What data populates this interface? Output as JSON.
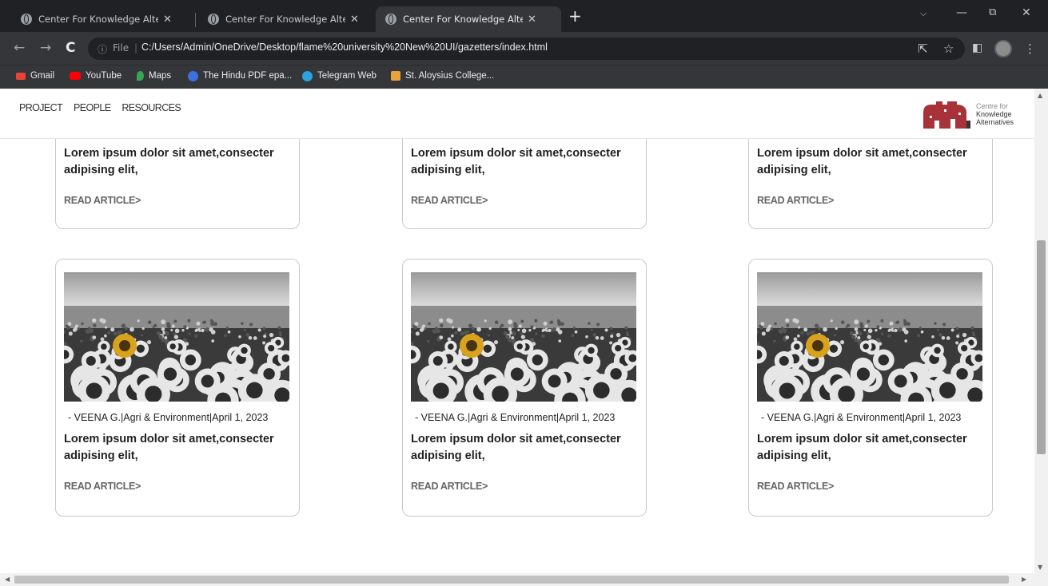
{
  "browser": {
    "tabs": [
      {
        "title": "Center For Knowledge Alternative",
        "active": false
      },
      {
        "title": "Center For Knowledge Alternative",
        "active": false
      },
      {
        "title": "Center For Knowledge Alternative",
        "active": true
      }
    ],
    "close_glyph": "✕",
    "new_tab_glyph": "+",
    "nav": {
      "back": "←",
      "forward": "→",
      "reload": "C"
    },
    "omnibox": {
      "info_glyph": "ⓘ",
      "scheme_label": "File",
      "url": "C:/Users/Admin/OneDrive/Desktop/flame%20university%20New%20UI/gazetters/index.html"
    },
    "bookmarks": [
      {
        "label": "Gmail",
        "icon": "gmail-icon",
        "color": "#ea4335"
      },
      {
        "label": "YouTube",
        "icon": "youtube-icon",
        "color": "#ff0000"
      },
      {
        "label": "Maps",
        "icon": "maps-icon",
        "color": "#34a853"
      },
      {
        "label": "The Hindu PDF epa...",
        "icon": "hindu-icon",
        "color": "#4285f4"
      },
      {
        "label": "Telegram Web",
        "icon": "telegram-icon",
        "color": "#2aa3df"
      },
      {
        "label": "St. Aloysius College...",
        "icon": "college-icon",
        "color": "#e8a33d"
      }
    ]
  },
  "site": {
    "nav": [
      "PROJECT",
      "PEOPLE",
      "RESOURCES"
    ],
    "logo": {
      "line1": "Centre for",
      "line2": "Knowledge",
      "line3": "Alternatives",
      "color": "#a8323a"
    }
  },
  "cards_top": [
    {
      "body": "Lorem ipsum dolor sit amet,consecter adipising elit,",
      "read": "READ ARTICLE>"
    },
    {
      "body": "Lorem ipsum dolor sit amet,consecter adipising elit,",
      "read": "READ ARTICLE>"
    },
    {
      "body": "Lorem ipsum dolor sit amet,consecter adipising elit,",
      "read": "READ ARTICLE>"
    }
  ],
  "cards_bottom": [
    {
      "meta": "- VEENA G.|Agri & Environment|April 1, 2023",
      "body": "Lorem ipsum dolor sit amet,consecter adipising elit,",
      "read": "READ ARTICLE>"
    },
    {
      "meta": "- VEENA G.|Agri & Environment|April 1, 2023",
      "body": "Lorem ipsum dolor sit amet,consecter adipising elit,",
      "read": "READ ARTICLE>"
    },
    {
      "meta": "- VEENA G.|Agri & Environment|April 1, 2023",
      "body": "Lorem ipsum dolor sit amet,consecter adipising elit,",
      "read": "READ ARTICLE>"
    }
  ]
}
